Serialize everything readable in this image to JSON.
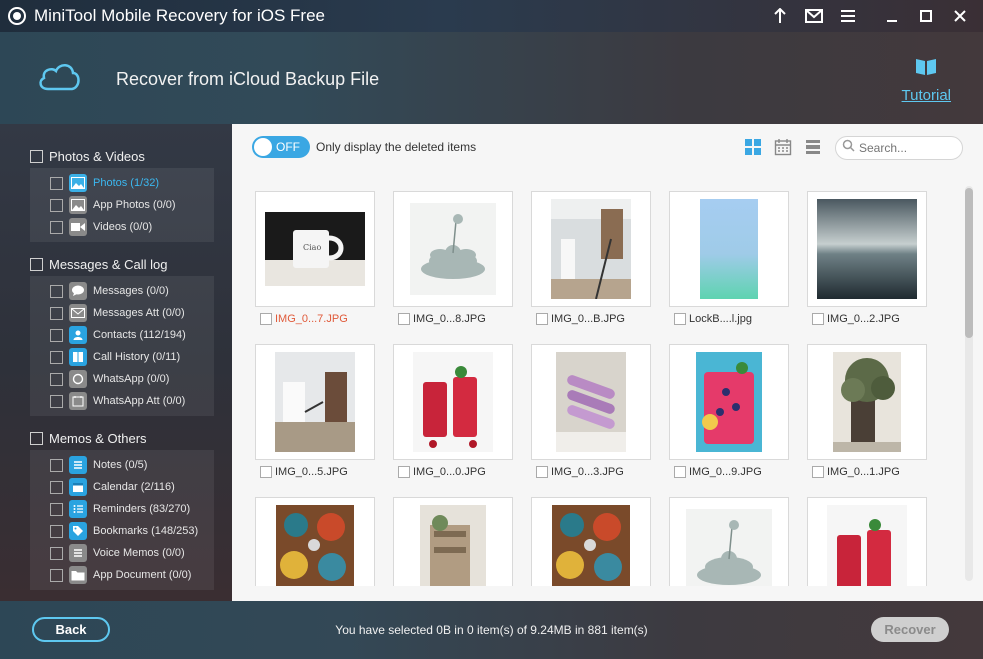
{
  "app": {
    "title": "MiniTool Mobile Recovery for iOS Free"
  },
  "header": {
    "title": "Recover from iCloud Backup File",
    "tutorial_label": "Tutorial"
  },
  "sidebar": {
    "groups": [
      {
        "label": "Photos & Videos",
        "items": [
          {
            "label": "Photos (1/32)",
            "icon": "photos-icon",
            "active": true
          },
          {
            "label": "App Photos (0/0)",
            "icon": "app-photos-icon"
          },
          {
            "label": "Videos (0/0)",
            "icon": "videos-icon"
          }
        ]
      },
      {
        "label": "Messages & Call log",
        "items": [
          {
            "label": "Messages (0/0)",
            "icon": "messages-icon"
          },
          {
            "label": "Messages Att (0/0)",
            "icon": "messages-attachment-icon"
          },
          {
            "label": "Contacts (112/194)",
            "icon": "contacts-icon"
          },
          {
            "label": "Call History (0/11)",
            "icon": "call-history-icon"
          },
          {
            "label": "WhatsApp (0/0)",
            "icon": "whatsapp-icon"
          },
          {
            "label": "WhatsApp Att (0/0)",
            "icon": "whatsapp-attachment-icon"
          }
        ]
      },
      {
        "label": "Memos & Others",
        "items": [
          {
            "label": "Notes (0/5)",
            "icon": "notes-icon"
          },
          {
            "label": "Calendar (2/116)",
            "icon": "calendar-icon"
          },
          {
            "label": "Reminders (83/270)",
            "icon": "reminders-icon"
          },
          {
            "label": "Bookmarks (148/253)",
            "icon": "bookmarks-icon"
          },
          {
            "label": "Voice Memos (0/0)",
            "icon": "voice-memos-icon"
          },
          {
            "label": "App Document (0/0)",
            "icon": "app-document-icon"
          }
        ]
      }
    ]
  },
  "toolbar": {
    "toggle_label": "OFF",
    "only_deleted_label": "Only display the deleted items",
    "search_placeholder": "Search..."
  },
  "grid": {
    "rows": [
      [
        {
          "name": "IMG_0...7.JPG",
          "deleted": true
        },
        {
          "name": "IMG_0...8.JPG"
        },
        {
          "name": "IMG_0...B.JPG"
        },
        {
          "name": "LockB....l.jpg"
        },
        {
          "name": "IMG_0...2.JPG"
        }
      ],
      [
        {
          "name": "IMG_0...5.JPG"
        },
        {
          "name": "IMG_0...0.JPG"
        },
        {
          "name": "IMG_0...3.JPG"
        },
        {
          "name": "IMG_0...9.JPG"
        },
        {
          "name": "IMG_0...1.JPG"
        }
      ],
      [
        {
          "name": ""
        },
        {
          "name": ""
        },
        {
          "name": ""
        },
        {
          "name": ""
        },
        {
          "name": ""
        }
      ]
    ]
  },
  "footer": {
    "back_label": "Back",
    "status": "You have selected 0B in 0 item(s) of 9.24MB in 881 item(s)",
    "recover_label": "Recover"
  },
  "colors": {
    "accent": "#3aa7e3",
    "deleted_text": "#e05a3a",
    "link": "#5ec8f0"
  }
}
